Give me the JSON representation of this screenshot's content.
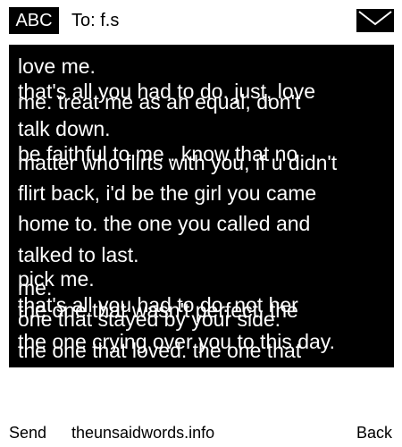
{
  "header": {
    "input_mode": "ABC",
    "recipient": "To: f.s"
  },
  "message": {
    "lines": [
      "love me.",
      "that's all you had to do. just, love",
      "me. treat me as an equal, don't",
      "talk down.",
      "be faithful to me . know that no",
      "matter who flirts with you, if u didn't",
      "flirt back, i'd be the girl you came",
      "home to. the one you called and",
      "talked to last.",
      "pick me.",
      "me.",
      "that's all you had to do. not her",
      "the one that wasn't perfect. the",
      "one that stayed by your side.",
      "the one crying over you to this day.",
      "the one that loved. the one that"
    ]
  },
  "footer": {
    "send_label": "Send",
    "site_label": "theunsaidwords.info",
    "back_label": "Back"
  }
}
